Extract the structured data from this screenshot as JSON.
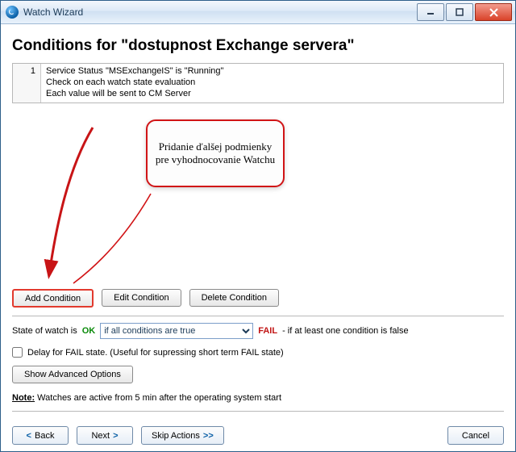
{
  "window": {
    "title": "Watch Wizard"
  },
  "heading": "Conditions for \"dostupnost Exchange servera\"",
  "conditions": [
    {
      "index": "1",
      "line1": "Service Status \"MSExchangeIS\" is \"Running\"",
      "line2": "Check on each watch state evaluation",
      "line3": "Each value will be sent to CM Server"
    }
  ],
  "callout_text": "Pridanie ďalšej podmienky pre vyhodnocovanie Watchu",
  "buttons": {
    "add": "Add Condition",
    "edit": "Edit Condition",
    "delete": "Delete Condition",
    "advanced": "Show Advanced Options",
    "back": "Back",
    "next": "Next",
    "skip": "Skip Actions",
    "cancel": "Cancel"
  },
  "state": {
    "prefix": "State of watch is",
    "ok": "OK",
    "combo_value": "if all conditions are true",
    "fail": "FAIL",
    "suffix": "- if at least one condition is false"
  },
  "delay_checkbox": "Delay for FAIL state. (Useful for supressing short term FAIL state)",
  "note": {
    "label": "Note:",
    "text": "Watches are active from 5 min after the operating system start"
  }
}
